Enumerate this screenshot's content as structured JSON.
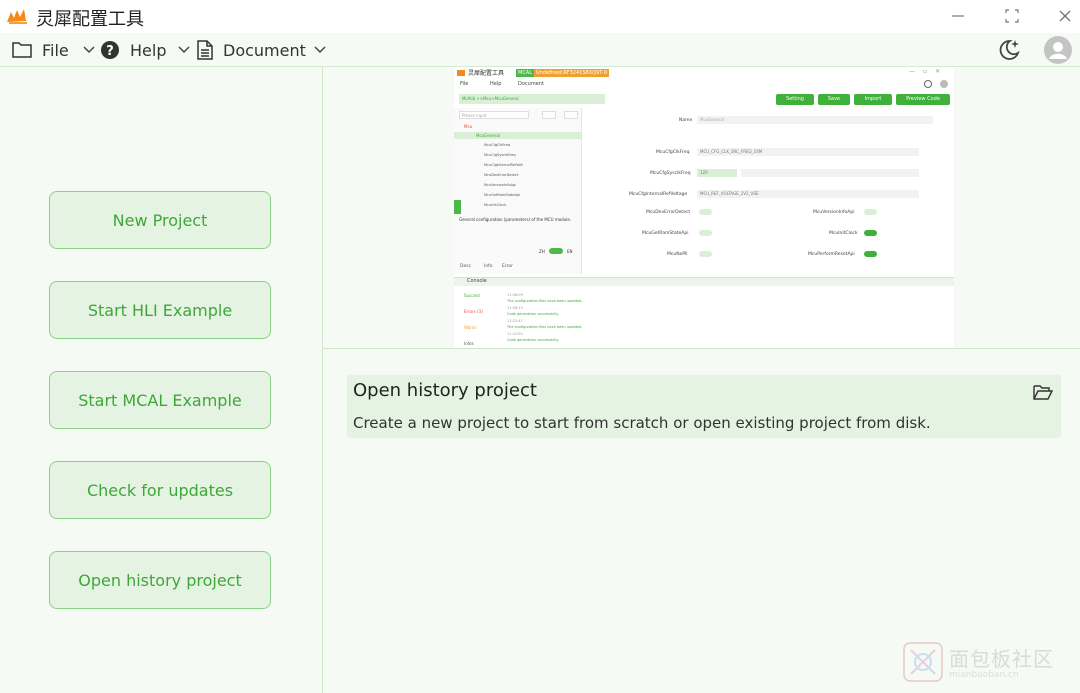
{
  "window": {
    "title": "灵犀配置工具",
    "controls": {
      "minimize": "—",
      "maximize": "⛶",
      "close": "✕"
    }
  },
  "menu": {
    "items": [
      {
        "label": "File",
        "icon": "folder-icon"
      },
      {
        "label": "Help",
        "icon": "help-circle-icon"
      },
      {
        "label": "Document",
        "icon": "document-icon"
      }
    ]
  },
  "actions": [
    {
      "label": "New Project"
    },
    {
      "label": "Start HLI Example"
    },
    {
      "label": "Start MCAL Example"
    },
    {
      "label": "Check for updates"
    },
    {
      "label": "Open history project"
    }
  ],
  "info": {
    "title": "Open history project",
    "description": "Create a new project to start from scratch or open existing project from disk.",
    "icon": "open-folder-icon"
  },
  "preview": {
    "app_title": "灵犀配置工具",
    "badge_mcal": "MCAL",
    "badge_project": "Undefined:RF3241S8XQ9T-0",
    "menu": [
      "File",
      "Help",
      "Document"
    ],
    "path": "McAlib >>Mcu>McuGeneral",
    "buttons": [
      "Setting",
      "Save",
      "Import",
      "Preview Code"
    ],
    "search_placeholder": "Please input",
    "tree": [
      "Mcu",
      "McuGeneral",
      "McuCfgClkFreq",
      "McuCfgSysclkFreq",
      "McuCfgInternalRefVolt",
      "McuVersionInfoApi",
      "McuDevErrorDetect",
      "McuVersionInfoApi",
      "McuGetRamStateApi",
      "McuInitClock"
    ],
    "tree_values": [
      "MCU_CFG_CLK_SRC_FREQ_16M",
      "120",
      "MCU_REF_VOLTAGE",
      "false",
      "false",
      "false",
      "false",
      "true"
    ],
    "desc_text": "General configuration (parameters) of the MCU module.",
    "lang_left": "ZH",
    "lang_right": "EN",
    "tabs": [
      "Desc",
      "Info",
      "Error"
    ],
    "name_label": "Name",
    "name_value": "McuGeneral",
    "fields": [
      {
        "label": "McuCfgClkFreq",
        "value": "MCU_CFG_CLK_SRC_FREQ_16M"
      },
      {
        "label": "McuCfgSysclkFreq",
        "value": "120"
      },
      {
        "label": "McuCfgInternalRefVoltage",
        "value": "MCU_REF_VOLTAGE_1V2_USE"
      }
    ],
    "toggles": [
      {
        "label": "McuDevErrorDetect",
        "on": false
      },
      {
        "label": "McuVersionInfoApi",
        "on": false
      },
      {
        "label": "McuGetRamStateApi",
        "on": false
      },
      {
        "label": "McuInitClock",
        "on": true
      },
      {
        "label": "McuNoPll",
        "on": false
      },
      {
        "label": "McuPerformResetApi",
        "on": true
      }
    ],
    "console_title": "Console",
    "console_tabs": [
      "Success",
      "Errors (3)",
      "Warns",
      "Infos"
    ],
    "console_lines": [
      "11:58:09",
      "The configuration files have been updated.",
      "11:58:13",
      "Code generation successfully.",
      "11:22:47",
      "The configuration files have been updated.",
      "11:22:50",
      "Code generation successfully."
    ]
  },
  "watermark": {
    "text": "面包板社区",
    "url": "mianbaoban.cn"
  },
  "colors": {
    "accent": "#3fa63a",
    "accent_bg": "#e5f4e2",
    "border": "#8ccf86",
    "page_bg": "#f5faf4"
  }
}
